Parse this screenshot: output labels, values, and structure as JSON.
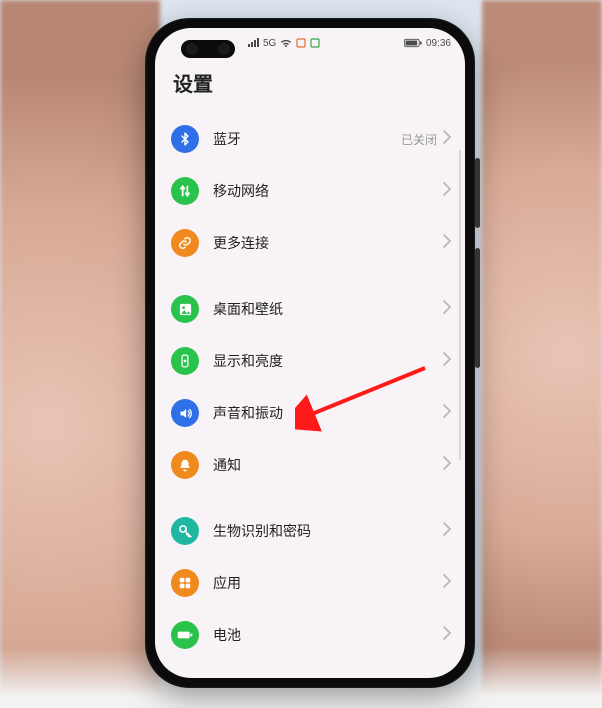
{
  "status": {
    "signal_label": "5G",
    "battery_text": "",
    "time": "09:36"
  },
  "page": {
    "title": "设置"
  },
  "rows": {
    "bluetooth": {
      "label": "蓝牙",
      "value": "已关闭"
    },
    "mobile_network": {
      "label": "移动网络"
    },
    "more_connections": {
      "label": "更多连接"
    },
    "desktop_wallpaper": {
      "label": "桌面和壁纸"
    },
    "display_brightness": {
      "label": "显示和亮度"
    },
    "sound_vibration": {
      "label": "声音和振动"
    },
    "notifications": {
      "label": "通知"
    },
    "biometrics_password": {
      "label": "生物识别和密码"
    },
    "apps": {
      "label": "应用"
    },
    "battery": {
      "label": "电池"
    }
  },
  "colors": {
    "blue": "#2f6fe8",
    "green": "#29c24a",
    "orange": "#f08a1f",
    "teal": "#1fb7a0"
  }
}
